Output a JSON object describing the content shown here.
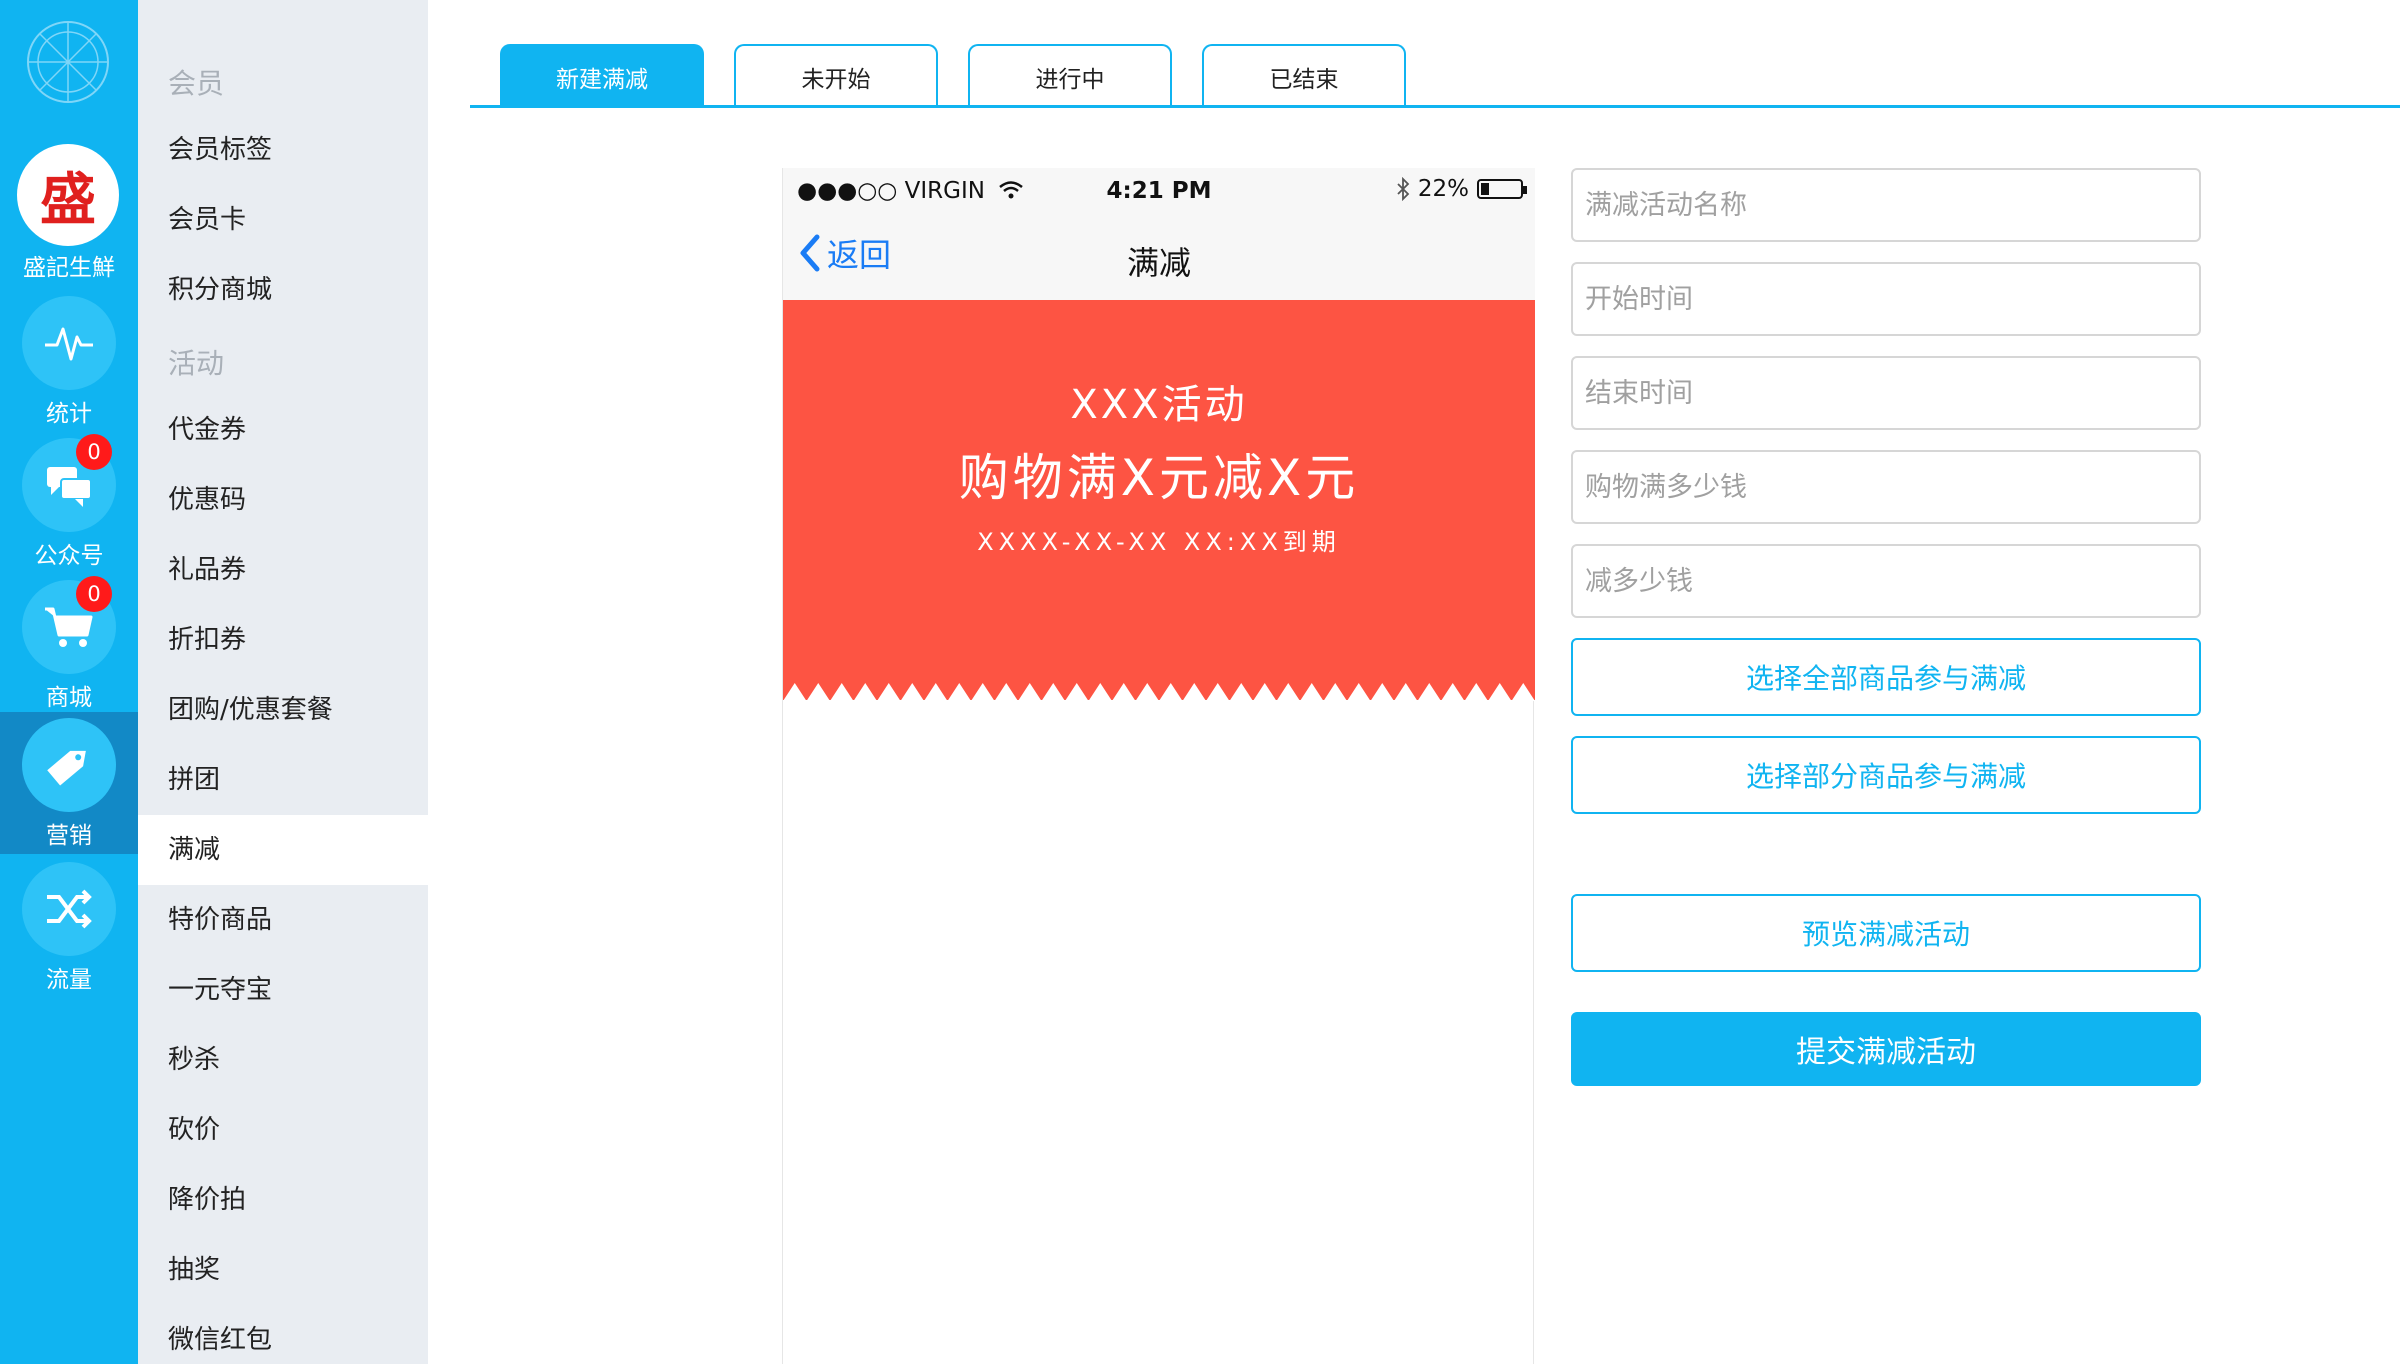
{
  "brand": {
    "char": "盛",
    "name": "盛記生鮮"
  },
  "rail": [
    {
      "id": "stats",
      "label": "统计",
      "icon": "pulse-icon"
    },
    {
      "id": "wechat",
      "label": "公众号",
      "icon": "chat-bubbles-icon",
      "badge": "0"
    },
    {
      "id": "shop",
      "label": "商城",
      "icon": "cart-icon",
      "badge": "0"
    },
    {
      "id": "marketing",
      "label": "营销",
      "icon": "tag-icon",
      "active": true
    },
    {
      "id": "traffic",
      "label": "流量",
      "icon": "shuffle-icon"
    }
  ],
  "menu": {
    "section_member": "会员",
    "member_items": [
      "会员标签",
      "会员卡",
      "积分商城"
    ],
    "section_activity": "活动",
    "activity_items": [
      "代金券",
      "优惠码",
      "礼品券",
      "折扣券",
      "团购/优惠套餐",
      "拼团",
      "满减",
      "特价商品",
      "一元夺宝",
      "秒杀",
      "砍价",
      "降价拍",
      "抽奖",
      "微信红包"
    ],
    "active_item": "满减"
  },
  "tabs": [
    "新建满减",
    "未开始",
    "进行中",
    "已结束"
  ],
  "active_tab": "新建满减",
  "phone": {
    "carrier": "●●●○○ VIRGIN",
    "time": "4:21 PM",
    "battery": "22%",
    "battery_level": 0.22,
    "back_label": "返回",
    "title": "满减",
    "banner_line1": "XXX活动",
    "banner_line2": "购物满X元减X元",
    "banner_line3": "XXXX-XX-XX XX:XX到期",
    "banner_color": "#fd5443"
  },
  "form": {
    "name_placeholder": "满减活动名称",
    "start_placeholder": "开始时间",
    "end_placeholder": "结束时间",
    "threshold_placeholder": "购物满多少钱",
    "discount_placeholder": "减多少钱",
    "select_all_label": "选择全部商品参与满减",
    "select_some_label": "选择部分商品参与满减",
    "preview_label": "预览满减活动",
    "submit_label": "提交满减活动"
  },
  "colors": {
    "accent": "#10b4f1",
    "rail_active": "#1289c6",
    "badge": "#ff1a1a"
  }
}
